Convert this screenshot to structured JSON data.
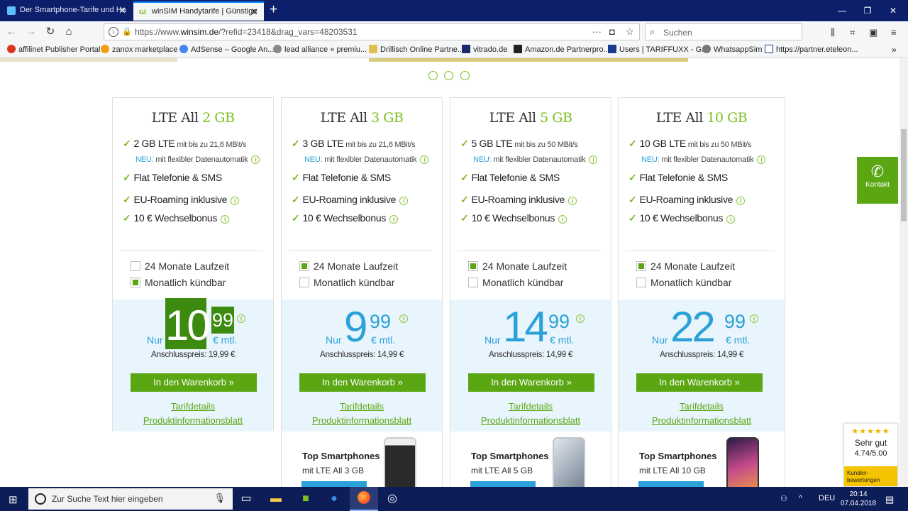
{
  "browser": {
    "tabs": [
      {
        "title": "Der Smartphone-Tarife und Ha"
      },
      {
        "title": "winSIM Handytarife | Günstige"
      }
    ],
    "new_tab": "+",
    "url_prefix": "https://www.",
    "url_domain": "winsim.de",
    "url_rest": "/?refid=23418&drag_vars=48203531",
    "search_placeholder": "Suchen",
    "bookmarks": [
      "affilinet Publisher Portal",
      "zanox marketplace",
      "AdSense – Google An...",
      "lead alliance » premiu...",
      "Drillisch Online Partne...",
      "vitrado.de",
      "Amazon.de Partnerpro...",
      "Users | TARIFFUXX - G...",
      "WhatsappSim",
      "https://partner.eteleon..."
    ]
  },
  "cards": [
    {
      "title_pre": "LTE All ",
      "title_gb": "2 GB",
      "feat1_bold": "2 GB LTE",
      "feat1_small": " mit bis zu 21,6 MBit/s",
      "neu_label": "NEU:",
      "neu_text": " mit flexibler Datenautomatik",
      "feat2": "Flat Telefonie & SMS",
      "feat3": "EU-Roaming inklusive",
      "feat4": "10 € Wechselbonus",
      "opt1": "24 Monate Laufzeit",
      "opt1_checked": false,
      "opt2": "Monatlich kündbar",
      "opt2_checked": true,
      "nur": "Nur",
      "euros": "10",
      "cents": "99",
      "mtl": "€ mtl.",
      "anschluss": "Anschlusspreis: 19,99 €",
      "cart": "In den Warenkorb »",
      "link1": "Tarifdetails",
      "link2": "Produktinformationsblatt"
    },
    {
      "title_pre": "LTE All ",
      "title_gb": "3 GB",
      "feat1_bold": "3 GB LTE",
      "feat1_small": " mit bis zu 21,6 MBit/s",
      "neu_label": "NEU:",
      "neu_text": " mit flexibler Datenautomatik",
      "feat2": "Flat Telefonie & SMS",
      "feat3": "EU-Roaming inklusive",
      "feat4": "10 € Wechselbonus",
      "opt1": "24 Monate Laufzeit",
      "opt1_checked": true,
      "opt2": "Monatlich kündbar",
      "opt2_checked": false,
      "nur": "Nur",
      "euros": "9",
      "cents": "99",
      "mtl": "€ mtl.",
      "anschluss": "Anschlusspreis: 14,99 €",
      "cart": "In den Warenkorb »",
      "link1": "Tarifdetails",
      "link2": "Produktinformationsblatt",
      "phones_title": "Top Smartphones",
      "phones_sub": "mit LTE All 3 GB"
    },
    {
      "title_pre": "LTE All ",
      "title_gb": "5 GB",
      "feat1_bold": "5 GB LTE",
      "feat1_small": " mit bis zu 50 MBit/s",
      "neu_label": "NEU:",
      "neu_text": " mit flexibler Datenautomatik",
      "feat2": "Flat Telefonie & SMS",
      "feat3": "EU-Roaming inklusive",
      "feat4": "10 € Wechselbonus",
      "opt1": "24 Monate Laufzeit",
      "opt1_checked": true,
      "opt2": "Monatlich kündbar",
      "opt2_checked": false,
      "nur": "Nur",
      "euros": "14",
      "cents": "99",
      "mtl": "€ mtl.",
      "anschluss": "Anschlusspreis: 14,99 €",
      "cart": "In den Warenkorb »",
      "link1": "Tarifdetails",
      "link2": "Produktinformationsblatt",
      "phones_title": "Top Smartphones",
      "phones_sub": "mit LTE All 5 GB"
    },
    {
      "title_pre": "LTE All ",
      "title_gb": "10 GB",
      "feat1_bold": "10 GB LTE",
      "feat1_small": " mit bis zu 50 MBit/s",
      "neu_label": "NEU:",
      "neu_text": " mit flexibler Datenautomatik",
      "feat2": "Flat Telefonie & SMS",
      "feat3": "EU-Roaming inklusive",
      "feat4": "10 € Wechselbonus",
      "opt1": "24 Monate Laufzeit",
      "opt1_checked": true,
      "opt2": "Monatlich kündbar",
      "opt2_checked": false,
      "nur": "Nur",
      "euros": "22",
      "cents": "99",
      "mtl": "€ mtl.",
      "anschluss": "Anschlusspreis: 14,99 €",
      "cart": "In den Warenkorb »",
      "link1": "Tarifdetails",
      "link2": "Produktinformationsblatt",
      "phones_title": "Top Smartphones",
      "phones_sub": "mit LTE All 10 GB"
    }
  ],
  "kontakt": "Kontakt",
  "rating": {
    "stars": "★★★★★",
    "label": "Sehr gut",
    "score": "4.74/5.00",
    "footer": "Kunden-\nbewertungen"
  },
  "taskbar": {
    "search": "Zur Suche Text hier eingeben",
    "lang": "DEU",
    "time": "20:14",
    "date": "07.04.2018"
  },
  "colors": {
    "brand_green": "#5aa713",
    "accent_green": "#7cbf1f",
    "price_blue": "#2aa1d8",
    "price_bg": "#e9f5fc",
    "tabbar": "#0d1f6b"
  }
}
